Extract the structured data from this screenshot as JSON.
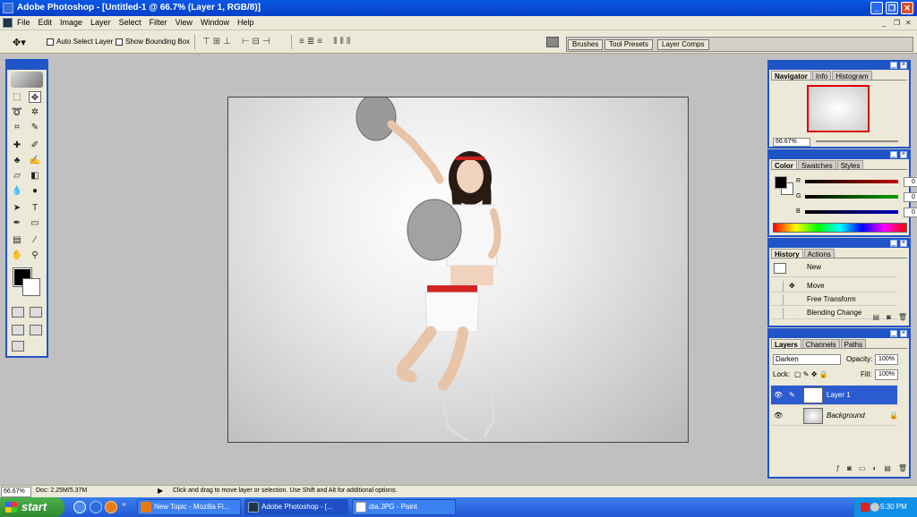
{
  "window": {
    "title": "Adobe Photoshop - [Untitled-1 @ 66.7% (Layer 1, RGB/8)]",
    "buttons": {
      "minimize": "_",
      "restore": "❐",
      "close": "✕"
    }
  },
  "menubar": {
    "items": [
      "File",
      "Edit",
      "Image",
      "Layer",
      "Select",
      "Filter",
      "View",
      "Window",
      "Help"
    ],
    "mdi_buttons": {
      "minimize": "_",
      "restore": "❐",
      "close": "✕"
    }
  },
  "options_bar": {
    "auto_select_label": "Auto Select Layer",
    "bounding_box_label": "Show Bounding Box",
    "well_tabs": [
      "Brushes",
      "Tool Presets",
      "Layer Comps"
    ]
  },
  "navigator": {
    "tabs": [
      "Navigator",
      "Info",
      "Histogram"
    ],
    "zoom": "66.67%"
  },
  "color_panel": {
    "tabs": [
      "Color",
      "Swatches",
      "Styles"
    ],
    "channels": [
      {
        "label": "R",
        "value": "0",
        "color": "#c00000"
      },
      {
        "label": "G",
        "value": "0",
        "color": "#00a000"
      },
      {
        "label": "B",
        "value": "0",
        "color": "#0000c0"
      }
    ]
  },
  "history_panel": {
    "tabs": [
      "History",
      "Actions"
    ],
    "states": [
      "New",
      "Move",
      "Free Transform",
      "Blending Change"
    ]
  },
  "layers_panel": {
    "tabs": [
      "Layers",
      "Channels",
      "Paths"
    ],
    "blend_mode": "Darken",
    "opacity_label": "Opacity:",
    "opacity": "100%",
    "lock_label": "Lock:",
    "fill_label": "Fill:",
    "fill": "100%",
    "layers": [
      {
        "name": "Layer 1",
        "selected": true
      },
      {
        "name": "Background",
        "selected": false
      }
    ]
  },
  "status_bar": {
    "zoom": "66.67%",
    "doc": "Doc: 2.25M/5.37M",
    "message": "Click and drag to move layer or selection.  Use Shift and Alt for additional options."
  },
  "taskbar": {
    "start_label": "start",
    "tasks": [
      {
        "label": "New Topic - Mozilla Fi...",
        "active": false
      },
      {
        "label": "Adobe Photoshop - [...",
        "active": true
      },
      {
        "label": "dia.JPG - Paint",
        "active": false
      }
    ],
    "clock": "5:30 PM"
  },
  "colors": {
    "xp_blue": "#0a58e6",
    "panel_bg": "#ece9d8",
    "selection": "#2c5bd0"
  }
}
